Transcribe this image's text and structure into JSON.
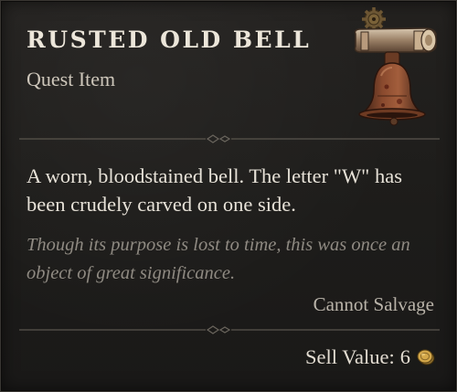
{
  "item": {
    "name": "RUSTED OLD BELL",
    "type": "Quest Item",
    "image_icon": "rusted-bell-icon",
    "description": "A worn, bloodstained bell. The letter \"W\" has been crudely carved on one side.",
    "flavor_text": "Though its purpose is lost to time, this was once an object of great significance.",
    "salvage_status": "Cannot Salvage",
    "sell_label": "Sell Value:",
    "sell_value": "6",
    "currency_icon": "gold-coin-icon"
  },
  "colors": {
    "background": "#1d1c1a",
    "title": "#ece6da",
    "flavor": "#8f8a82",
    "divider": "#5a554e"
  }
}
